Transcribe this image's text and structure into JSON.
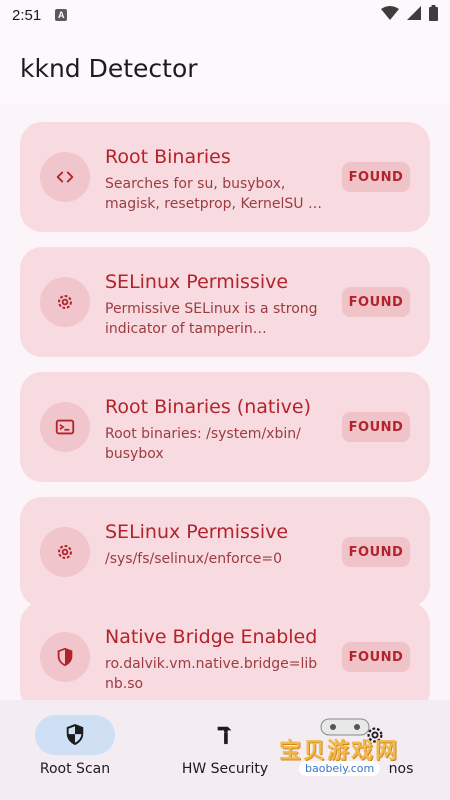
{
  "status_bar": {
    "time": "2:51",
    "notification_icon": "a-icon",
    "wifi_icon": "wifi-icon",
    "signal_icon": "signal-icon",
    "battery_icon": "battery-icon"
  },
  "app": {
    "title": "kknd Detector"
  },
  "detections": [
    {
      "title": "Root Binaries",
      "description": "Searches for su, busybox, magisk, resetprop, KernelSU …",
      "status": "FOUND",
      "icon": "code-icon"
    },
    {
      "title": "SELinux Permissive",
      "description": "Permissive SELinux is a strong indicator of tamperin…",
      "status": "FOUND",
      "icon": "gear-icon"
    },
    {
      "title": "Root Binaries (native)",
      "description": "Root binaries: /system/xbin/ busybox",
      "status": "FOUND",
      "icon": "terminal-icon"
    },
    {
      "title": "SELinux Permissive",
      "description": "/sys/fs/selinux/enforce=0",
      "status": "FOUND",
      "icon": "gear-icon"
    },
    {
      "title": "Native Bridge Enabled",
      "description": "ro.dalvik.vm.native.bridge=lib nb.so",
      "status": "FOUND",
      "icon": "shield-icon"
    }
  ],
  "nav": {
    "items": [
      {
        "label": "Root Scan",
        "icon": "shield-icon",
        "active": true
      },
      {
        "label": "HW Security",
        "icon": "hammer-icon",
        "active": false
      },
      {
        "label": "nos",
        "icon": "gear-icon",
        "active": false
      }
    ]
  },
  "watermark": {
    "text": "宝贝游戏网",
    "url": "baobeiy.com"
  },
  "colors": {
    "accent": "#b3232b",
    "card": "#f8dbe0",
    "badge": "#f0c3c9",
    "nav_active": "#cfe0f5"
  }
}
